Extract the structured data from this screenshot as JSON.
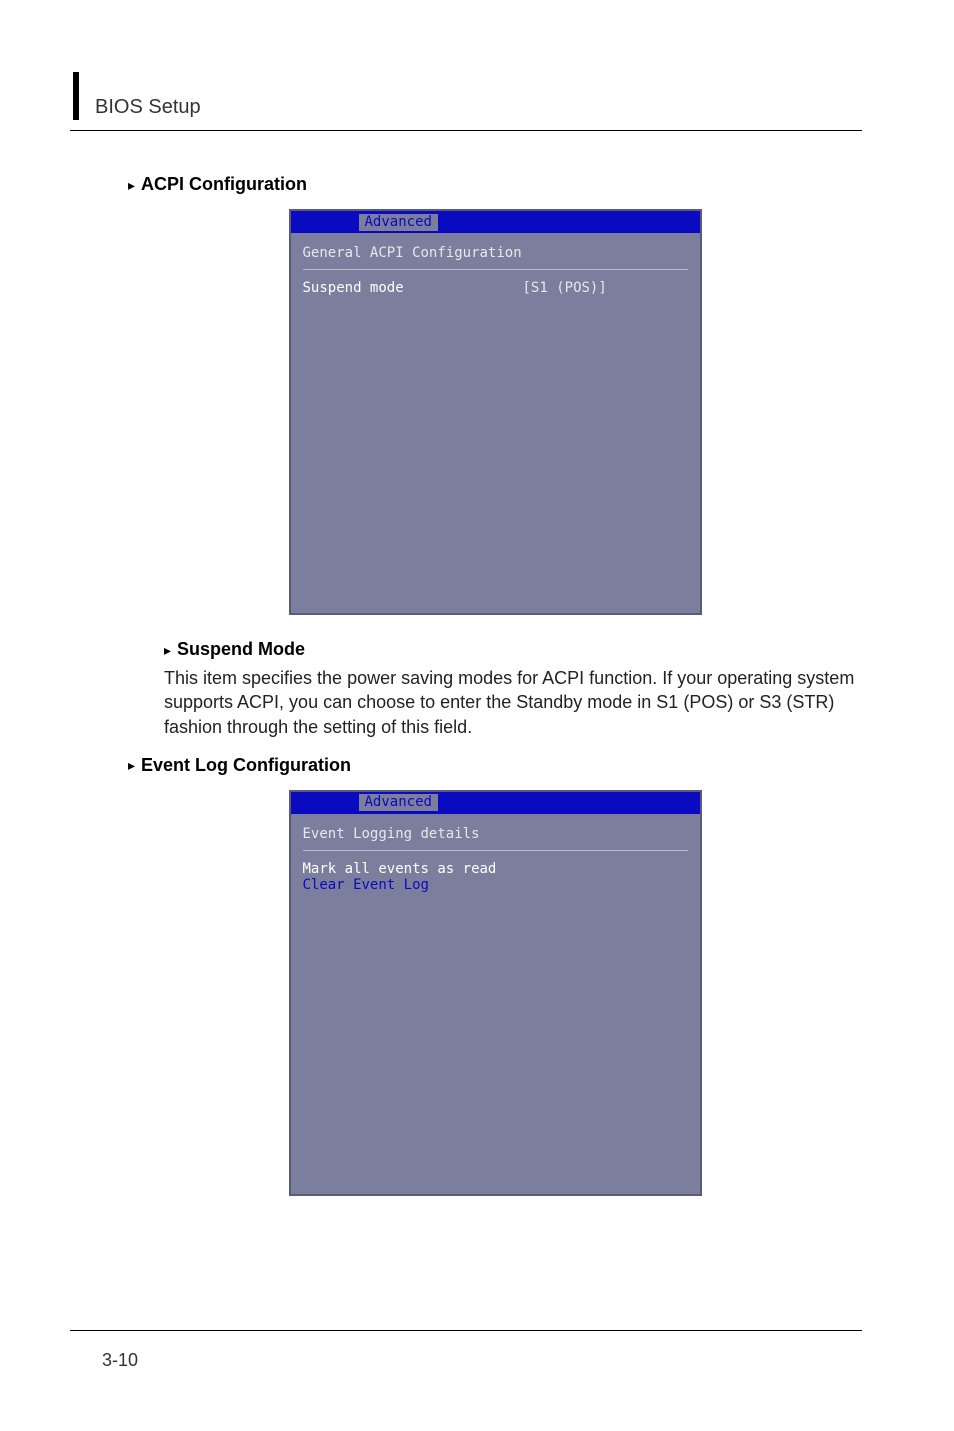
{
  "header": {
    "title": "BIOS Setup"
  },
  "sections": {
    "acpi": {
      "heading": "ACPI Configuration",
      "panel": {
        "tab": "Advanced",
        "section_title": "General ACPI Configuration",
        "row_label": "Suspend mode",
        "row_value": "[S1 (POS)]"
      },
      "sub_heading": "Suspend Mode",
      "body": "This item specifies the power saving modes for ACPI function. If your operating system supports ACPI, you can choose to enter the Standby mode in S1 (POS) or S3 (STR) fashion through the setting of this field."
    },
    "eventlog": {
      "heading": "Event Log Configuration",
      "panel": {
        "tab": "Advanced",
        "section_title": "Event Logging details",
        "action1": "Mark all events as read",
        "action2": "Clear Event Log"
      }
    }
  },
  "footer": {
    "page": "3-10"
  }
}
